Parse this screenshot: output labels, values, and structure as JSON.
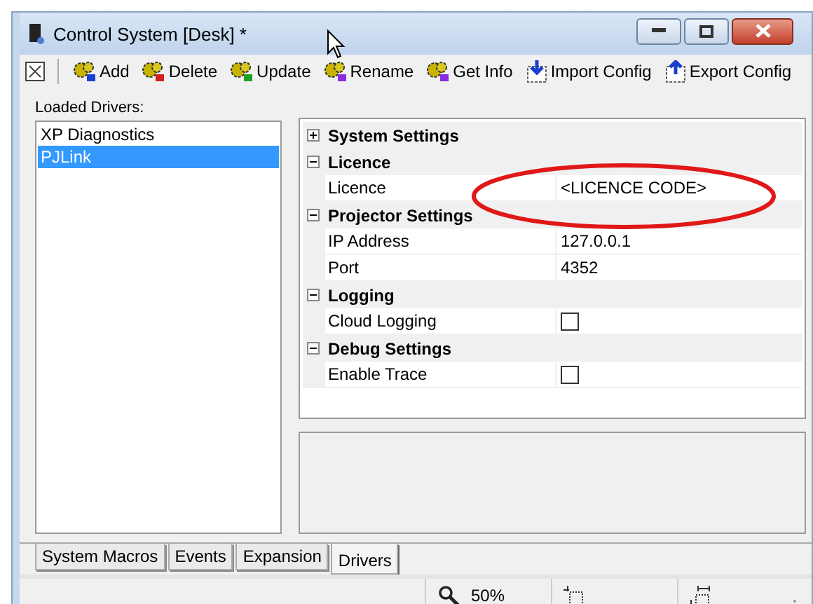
{
  "window": {
    "title": "Control System [Desk] *"
  },
  "toolbar": [
    {
      "label": "Add",
      "kind": "add"
    },
    {
      "label": "Delete",
      "kind": "delete"
    },
    {
      "label": "Update",
      "kind": "update"
    },
    {
      "label": "Rename",
      "kind": "rename"
    },
    {
      "label": "Get Info",
      "kind": "info"
    },
    {
      "label": "Import Config",
      "kind": "import"
    },
    {
      "label": "Export Config",
      "kind": "export"
    }
  ],
  "drivers": {
    "label": "Loaded Drivers:",
    "items": [
      {
        "name": "XP Diagnostics",
        "selected": false
      },
      {
        "name": "PJLink",
        "selected": true
      }
    ]
  },
  "property_grid": [
    {
      "category": "System Settings",
      "expanded": false
    },
    {
      "category": "Licence",
      "expanded": true,
      "properties": [
        {
          "name": "Licence",
          "kind": "text",
          "value": "<LICENCE CODE>"
        }
      ]
    },
    {
      "category": "Projector Settings",
      "expanded": true,
      "properties": [
        {
          "name": "IP Address",
          "kind": "text",
          "value": "127.0.0.1"
        },
        {
          "name": "Port",
          "kind": "text",
          "value": "4352"
        }
      ]
    },
    {
      "category": "Logging",
      "expanded": true,
      "properties": [
        {
          "name": "Cloud Logging",
          "kind": "checkbox",
          "checked": false
        }
      ]
    },
    {
      "category": "Debug Settings",
      "expanded": true,
      "properties": [
        {
          "name": "Enable Trace",
          "kind": "checkbox",
          "checked": false
        }
      ]
    }
  ],
  "tabs": [
    {
      "label": "System Macros",
      "selected": false
    },
    {
      "label": "Events",
      "selected": false
    },
    {
      "label": "Expansion",
      "selected": false
    },
    {
      "label": "Drivers",
      "selected": true
    }
  ],
  "status_bar": {
    "zoom": "50%"
  }
}
